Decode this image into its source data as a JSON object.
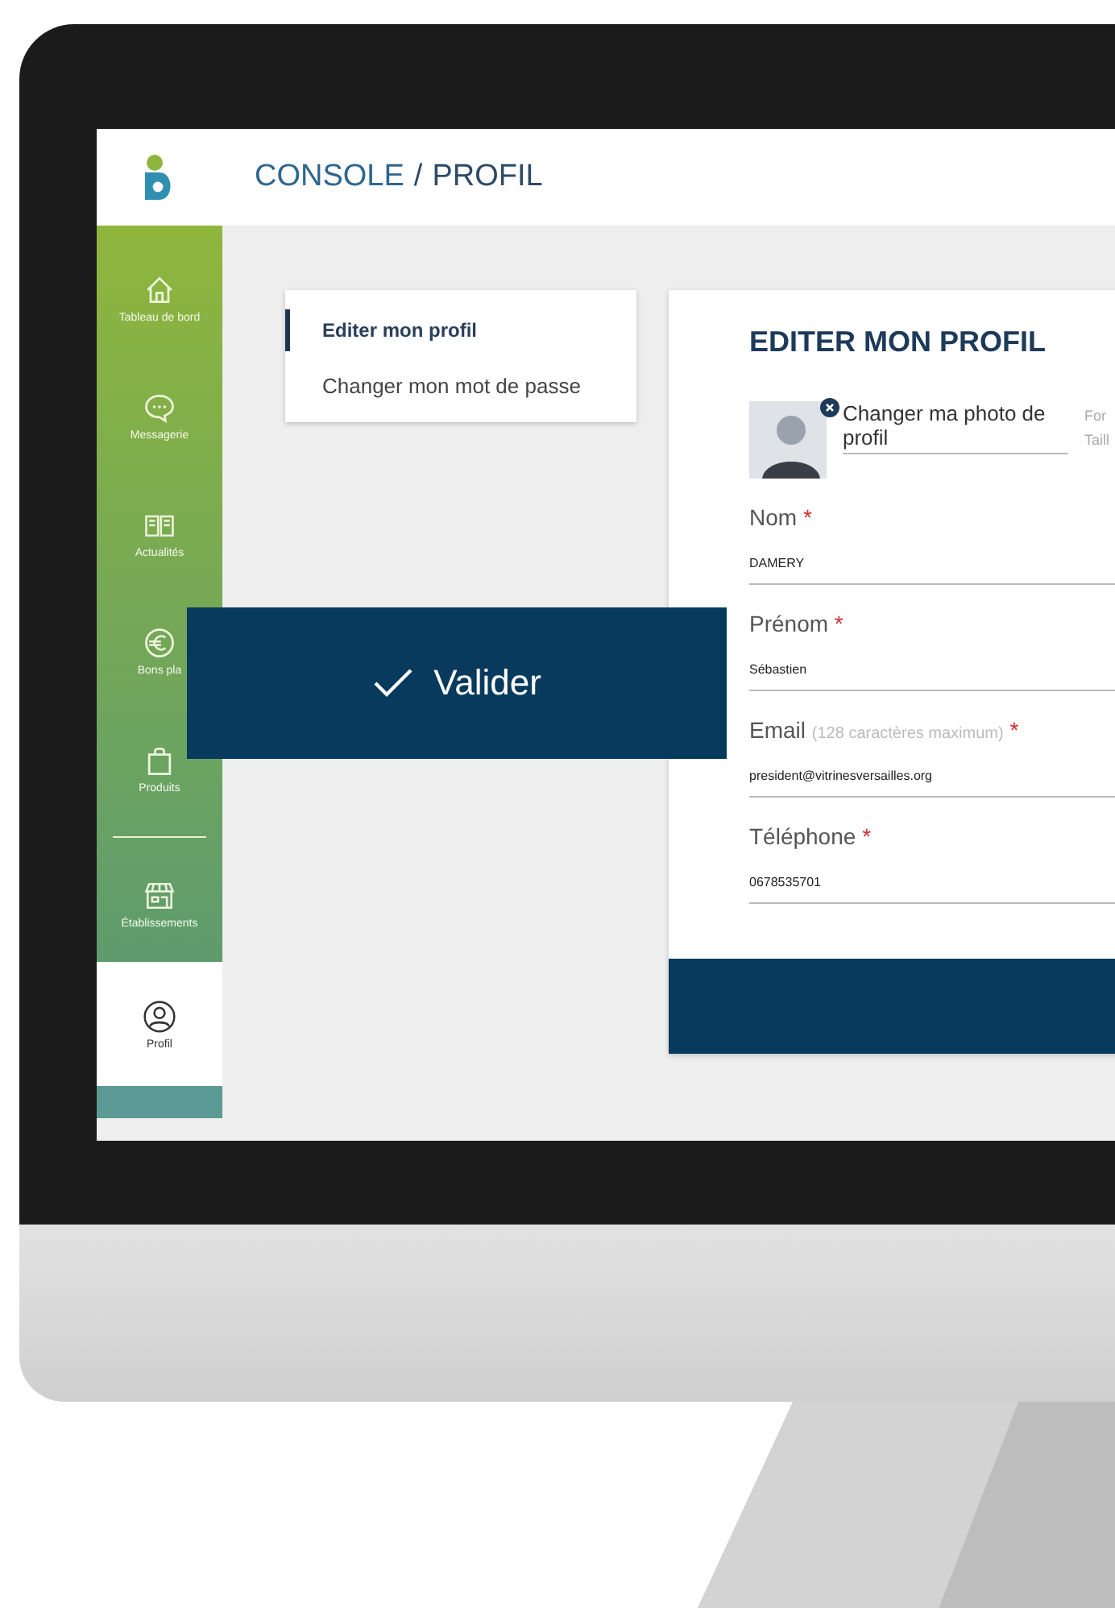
{
  "header": {
    "breadcrumb": [
      "CONSOLE",
      "PROFIL"
    ],
    "separator": "/"
  },
  "sidebar": {
    "items": [
      {
        "label": "Tableau de bord",
        "selected": false
      },
      {
        "label": "Messagerie",
        "selected": false
      },
      {
        "label": "Actualités",
        "selected": false
      },
      {
        "label": "Bons pla",
        "selected": false
      },
      {
        "label": "Produits",
        "selected": false
      },
      {
        "label": "Établissements",
        "selected": false
      },
      {
        "label": "Profil",
        "selected": true
      }
    ]
  },
  "submenu": [
    {
      "label": "Editer mon profil",
      "selected": true
    },
    {
      "label": "Changer mon mot de passe",
      "selected": false
    }
  ],
  "form": {
    "title": "EDITER MON PROFIL",
    "photo_link": "Changer ma photo de profil",
    "photo_hints": [
      "For",
      "Taill"
    ],
    "fields": [
      {
        "label": "Nom",
        "required_mark": "*",
        "value": "DAMERY"
      },
      {
        "label": "Prénom",
        "required_mark": "*",
        "value": "Sébastien"
      },
      {
        "label": "Email",
        "hint": "(128 caractères maximum)",
        "required_mark": "*",
        "value": "president@vitrinesversailles.org"
      },
      {
        "label": "Téléphone",
        "required_mark": "*",
        "value": "0678535701"
      }
    ]
  },
  "callout": {
    "label": "Valider"
  }
}
